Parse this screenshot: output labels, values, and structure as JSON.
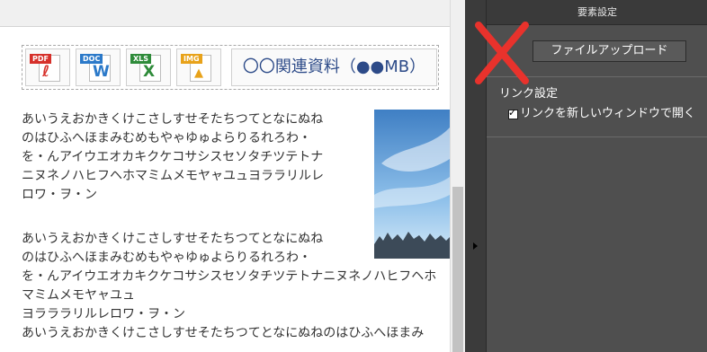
{
  "panel": {
    "title": "要素設定",
    "upload_button": "ファイルアップロード",
    "link_section": "リンク設定",
    "open_new_window": "リンクを新しいウィンドウで開く",
    "open_new_window_checked": true,
    "cross_color": "#e8322c"
  },
  "editor": {
    "files": [
      {
        "tag": "PDF",
        "icon": "pdf-icon",
        "color": "#d6302a"
      },
      {
        "tag": "DOC",
        "icon": "word-icon",
        "color": "#2b79c9"
      },
      {
        "tag": "XLS",
        "icon": "excel-icon",
        "color": "#2e8b3a"
      },
      {
        "tag": "IMG",
        "icon": "image-icon",
        "color": "#e8a21a"
      }
    ],
    "file_title": "〇〇関連資料（●●MB）",
    "para1": [
      "あいうえおかきくけこさしすせそたちつてとなにぬね",
      "のはひふへほまみむめもやゃゆゅよらりるれろわ・",
      "を・んアイウエオカキクケコサシスセソタチツテトナ",
      "ニヌネノハヒフヘホマミムメモヤャユュヨララリルレ",
      "ロワ・ヲ・ン"
    ],
    "para2": [
      "あいうえおかきくけこさしすせそたちつてとなにぬね",
      "のはひふへほまみむめもやゃゆゅよらりるれろわ・",
      "を・んアイウエオカキクケコサシスセソタチツテトナニヌネノハヒフヘホマミムメモヤャユュ",
      "ヨラララリルレロワ・ヲ・ン"
    ],
    "para3": [
      "あいうえおかきくけこさしすせそたちつてとなにぬねのはひふへほまみ"
    ]
  }
}
